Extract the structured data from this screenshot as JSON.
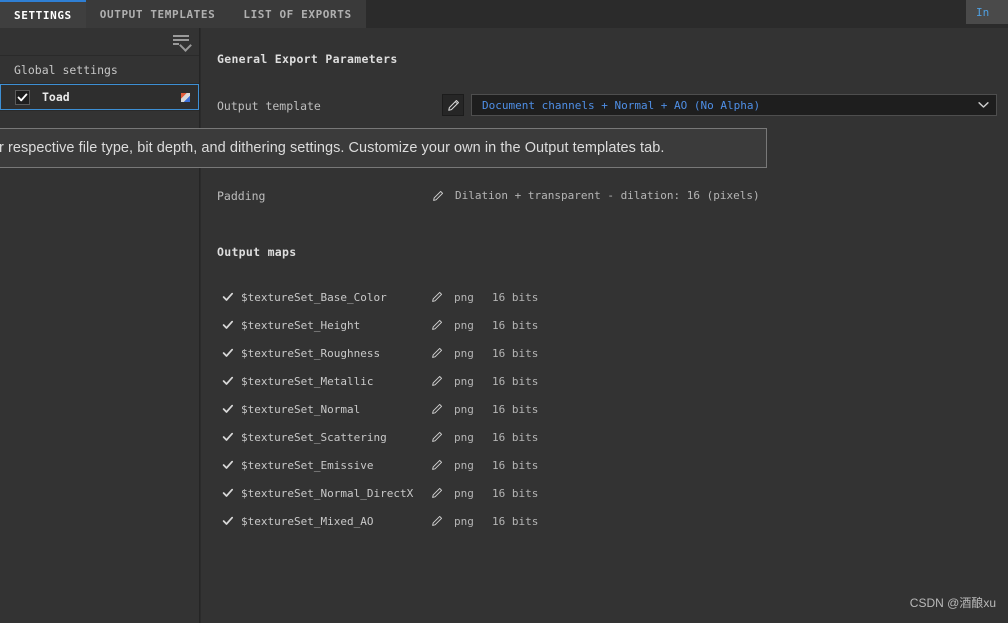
{
  "window": {
    "corner_panel_text": "In"
  },
  "tabs": [
    {
      "label": "SETTINGS",
      "active": true
    },
    {
      "label": "OUTPUT TEMPLATES",
      "active": false
    },
    {
      "label": "LIST OF EXPORTS",
      "active": false
    }
  ],
  "sidebar": {
    "filter_icon": "filter-list-icon",
    "group_header": "Global settings",
    "texture_sets": [
      {
        "label": "Toad",
        "checked": true,
        "thumbnail": "texture-thumbnail"
      }
    ]
  },
  "main": {
    "general_section_title": "General Export Parameters",
    "output_template": {
      "label": "Output template",
      "edit_icon": "pencil-icon",
      "value": "Document channels + Normal + AO (No Alpha)",
      "arrow_icon": "chevron-down-icon"
    },
    "padding": {
      "label": "Padding",
      "edit_icon": "pencil-icon",
      "value": "Dilation + transparent - dilation: 16 (pixels)"
    },
    "output_maps": {
      "title": "Output maps",
      "rows": [
        {
          "name": "$textureSet_Base_Color",
          "checked": true,
          "format": "png",
          "depth": "16 bits"
        },
        {
          "name": "$textureSet_Height",
          "checked": true,
          "format": "png",
          "depth": "16 bits"
        },
        {
          "name": "$textureSet_Roughness",
          "checked": true,
          "format": "png",
          "depth": "16 bits"
        },
        {
          "name": "$textureSet_Metallic",
          "checked": true,
          "format": "png",
          "depth": "16 bits"
        },
        {
          "name": "$textureSet_Normal",
          "checked": true,
          "format": "png",
          "depth": "16 bits"
        },
        {
          "name": "$textureSet_Scattering",
          "checked": true,
          "format": "png",
          "depth": "16 bits"
        },
        {
          "name": "$textureSet_Emissive",
          "checked": true,
          "format": "png",
          "depth": "16 bits"
        },
        {
          "name": "$textureSet_Normal_DirectX",
          "checked": true,
          "format": "png",
          "depth": "16 bits"
        },
        {
          "name": "$textureSet_Mixed_AO",
          "checked": true,
          "format": "png",
          "depth": "16 bits"
        }
      ]
    }
  },
  "tooltip": {
    "text": "r respective file type, bit depth, and dithering settings. Customize your own in the Output templates tab."
  },
  "watermark": {
    "text": "CSDN @酒酿xu"
  },
  "colors": {
    "accent_blue": "#3d8fd4",
    "value_blue": "#4f8fe6",
    "panel_bg": "#333333",
    "tab_bg": "#3c3c3c",
    "window_bg": "#2b2b2b"
  }
}
